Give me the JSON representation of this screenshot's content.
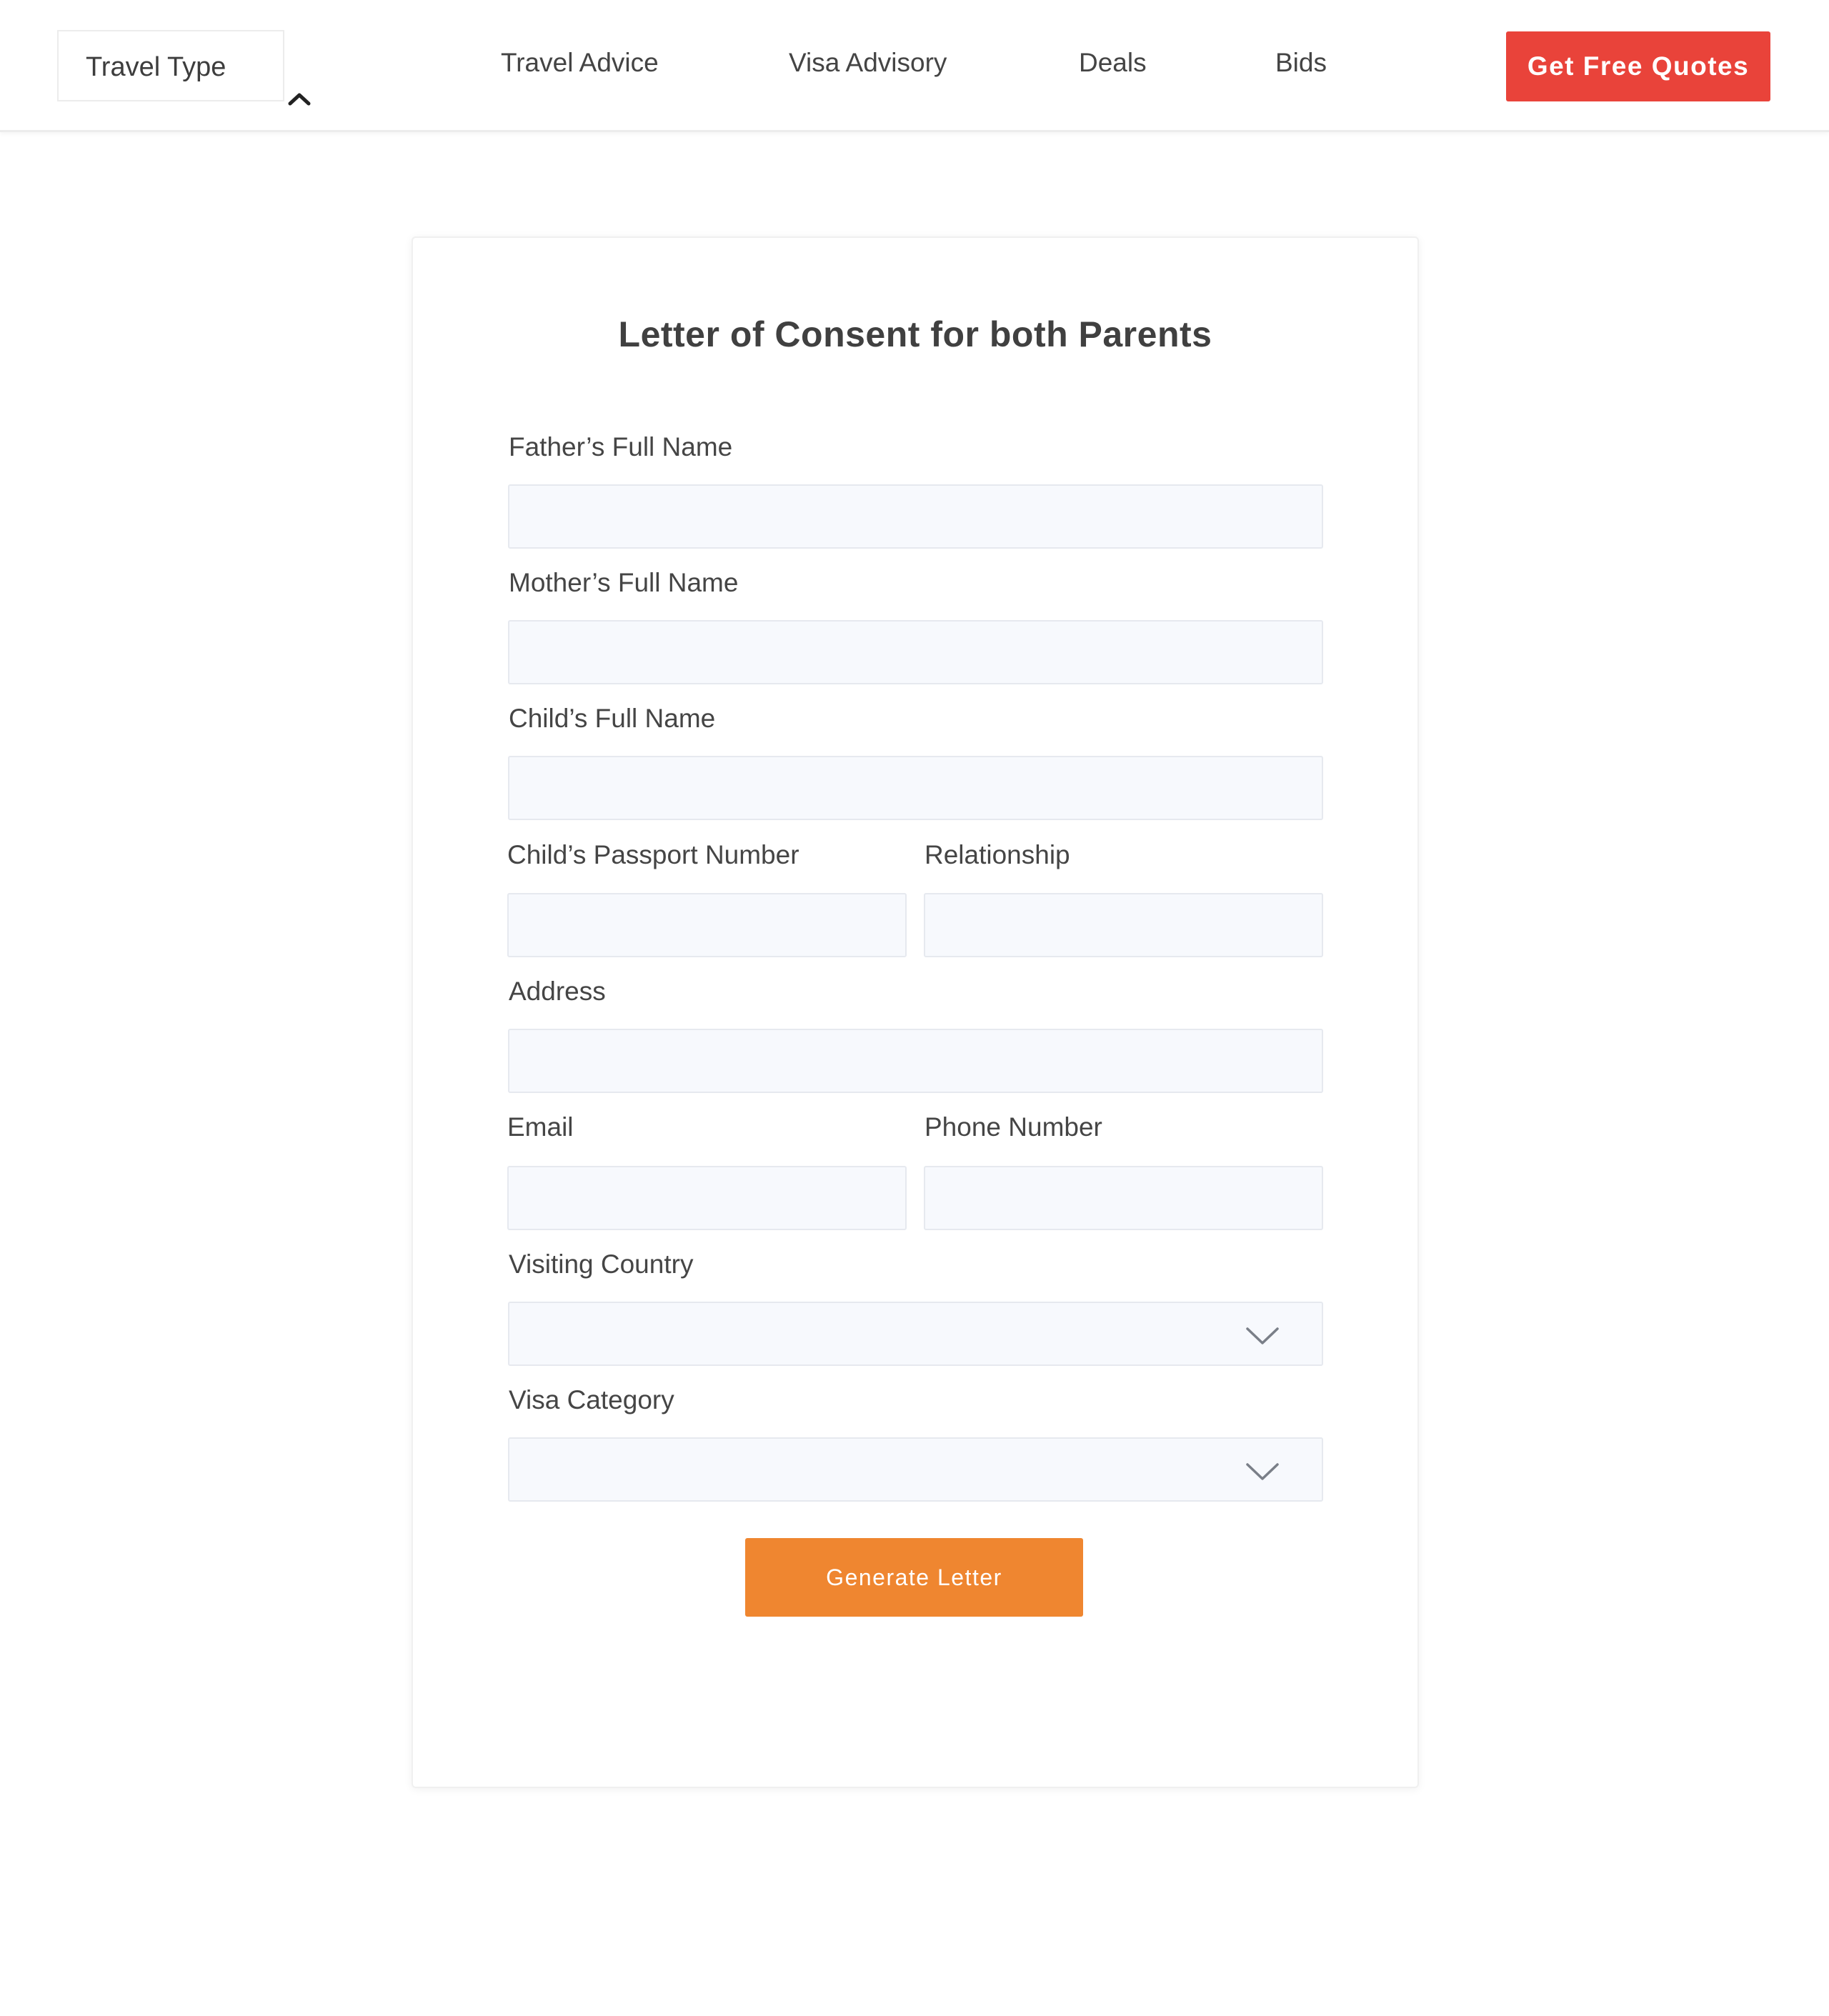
{
  "header": {
    "travel_type_label": "Travel Type",
    "nav": [
      {
        "label": "Travel Advice"
      },
      {
        "label": "Visa Advisory"
      },
      {
        "label": "Deals"
      },
      {
        "label": "Bids"
      }
    ],
    "cta_label": "Get Free Quotes"
  },
  "form": {
    "title": "Letter of Consent for both Parents",
    "fields": {
      "father_name": {
        "label": "Father’s Full Name",
        "value": ""
      },
      "mother_name": {
        "label": "Mother’s Full Name",
        "value": ""
      },
      "child_name": {
        "label": "Child’s Full Name",
        "value": ""
      },
      "passport_number": {
        "label": "Child’s Passport Number",
        "value": ""
      },
      "relationship": {
        "label": "Relationship",
        "value": ""
      },
      "address": {
        "label": "Address",
        "value": ""
      },
      "email": {
        "label": "Email",
        "value": ""
      },
      "phone": {
        "label": "Phone Number",
        "value": ""
      },
      "visiting_country": {
        "label": "Visiting Country",
        "value": ""
      },
      "visa_category": {
        "label": "Visa Category",
        "value": ""
      }
    },
    "submit_label": "Generate Letter"
  },
  "icons": {
    "travel_type_toggle": "chevron-up-icon",
    "select_toggle": "chevron-down-icon"
  },
  "colors": {
    "cta_red": "#e9433a",
    "submit_orange": "#ef8630",
    "input_background": "#f7f9fd",
    "input_border": "#e6e9ef",
    "text": "#454545"
  }
}
